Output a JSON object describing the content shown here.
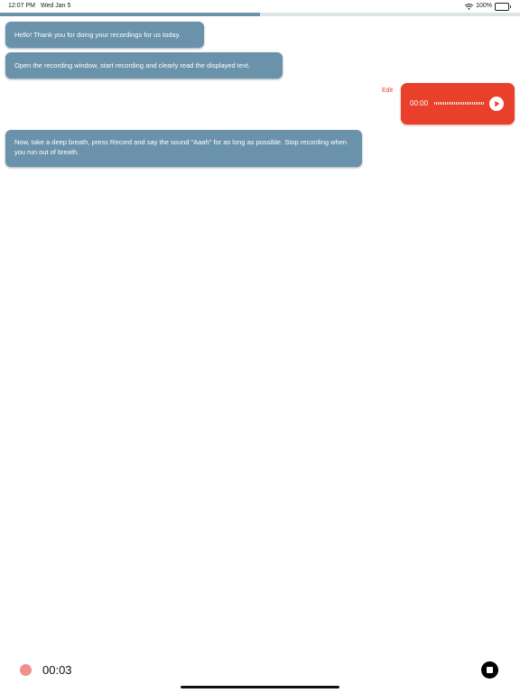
{
  "status_bar": {
    "time": "12:07 PM",
    "date": "Wed Jan 5",
    "battery": "100%",
    "icons": [
      "wifi-icon",
      "battery-icon"
    ]
  },
  "progress": {
    "fraction": 0.5,
    "color": "#6a93ab"
  },
  "messages": [
    {
      "text": "Hello! Thank you for doing your recordings for us today."
    },
    {
      "text": "Open the recording window, start recording and clearly read the displayed text."
    },
    {
      "text": "Now, take a deep breath, press Record and say the sound \"Aaah\" for as long as possible. Stop recording when you run out of breath."
    }
  ],
  "audio_message": {
    "edit_label": "Edit",
    "duration": "00:00",
    "icon": "play-icon"
  },
  "recorder": {
    "timer": "00:03",
    "stop_icon": "stop-icon",
    "indicator_icon": "record-dot"
  },
  "colors": {
    "bubble": "#6a93ab",
    "accent": "#e8402a",
    "record_dot": "#f08f8c"
  }
}
